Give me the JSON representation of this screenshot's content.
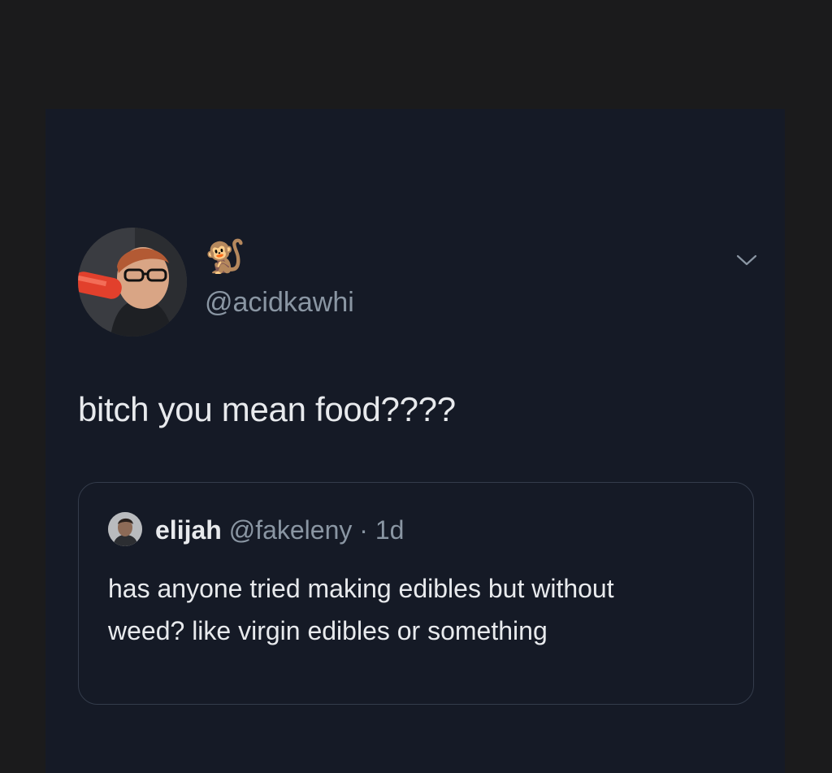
{
  "tweet": {
    "display_name": "🐒",
    "handle": "@acidkawhi",
    "text": "bitch you mean food????",
    "menu_icon": "chevron-down-icon"
  },
  "quoted_tweet": {
    "name": "elijah",
    "handle": "@fakeleny",
    "separator": " · ",
    "time": "1d",
    "text": "has anyone tried making edibles but without weed? like virgin edibles or something"
  },
  "colors": {
    "page_background": "#1b1b1c",
    "card_background": "#151a26",
    "primary_text": "#e8eaed",
    "secondary_text": "#8a96a3",
    "quote_border": "#343c4b"
  }
}
